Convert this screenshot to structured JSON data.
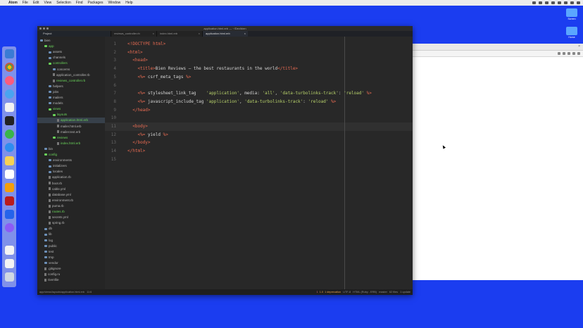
{
  "menubar": {
    "items": [
      "Atom",
      "File",
      "Edit",
      "View",
      "Selection",
      "Find",
      "Packages",
      "Window",
      "Help"
    ]
  },
  "desktop": {
    "icons": [
      "Screen",
      "Home"
    ]
  },
  "window": {
    "title": "application.html.erb — ~/Dev/bien",
    "project_tab": "Project",
    "tabs": [
      {
        "label": "reviews_controller.rb",
        "active": false
      },
      {
        "label": "index.html.erb",
        "active": false
      },
      {
        "label": "application.html.erb",
        "active": true
      }
    ],
    "close_glyph": "×"
  },
  "tree": [
    {
      "label": "bien",
      "depth": 0,
      "kind": "folder",
      "green": false
    },
    {
      "label": "app",
      "depth": 1,
      "kind": "folder",
      "green": true
    },
    {
      "label": "assets",
      "depth": 2,
      "kind": "folder",
      "green": false
    },
    {
      "label": "channels",
      "depth": 2,
      "kind": "folder",
      "green": false
    },
    {
      "label": "controllers",
      "depth": 2,
      "kind": "folder",
      "green": true
    },
    {
      "label": "concerns",
      "depth": 3,
      "kind": "folder",
      "green": false
    },
    {
      "label": "application_controller.rb",
      "depth": 3,
      "kind": "file",
      "green": false
    },
    {
      "label": "reviews_controller.rb",
      "depth": 3,
      "kind": "file",
      "green": true
    },
    {
      "label": "helpers",
      "depth": 2,
      "kind": "folder",
      "green": false
    },
    {
      "label": "jobs",
      "depth": 2,
      "kind": "folder",
      "green": false
    },
    {
      "label": "mailers",
      "depth": 2,
      "kind": "folder",
      "green": false
    },
    {
      "label": "models",
      "depth": 2,
      "kind": "folder",
      "green": false
    },
    {
      "label": "views",
      "depth": 2,
      "kind": "folder",
      "green": true
    },
    {
      "label": "layouts",
      "depth": 3,
      "kind": "folder",
      "green": true
    },
    {
      "label": "application.html.erb",
      "depth": 4,
      "kind": "file",
      "green": true,
      "selected": true
    },
    {
      "label": "mailer.html.erb",
      "depth": 4,
      "kind": "file",
      "green": false
    },
    {
      "label": "mailer.text.erb",
      "depth": 4,
      "kind": "file",
      "green": false
    },
    {
      "label": "reviews",
      "depth": 3,
      "kind": "folder",
      "green": true
    },
    {
      "label": "index.html.erb",
      "depth": 4,
      "kind": "file",
      "green": true
    },
    {
      "label": "bin",
      "depth": 1,
      "kind": "folder",
      "green": false
    },
    {
      "label": "config",
      "depth": 1,
      "kind": "folder",
      "green": true
    },
    {
      "label": "environments",
      "depth": 2,
      "kind": "folder",
      "green": false
    },
    {
      "label": "initializers",
      "depth": 2,
      "kind": "folder",
      "green": false
    },
    {
      "label": "locales",
      "depth": 2,
      "kind": "folder",
      "green": false
    },
    {
      "label": "application.rb",
      "depth": 2,
      "kind": "file",
      "green": false
    },
    {
      "label": "boot.rb",
      "depth": 2,
      "kind": "file",
      "green": false
    },
    {
      "label": "cable.yml",
      "depth": 2,
      "kind": "file",
      "green": false
    },
    {
      "label": "database.yml",
      "depth": 2,
      "kind": "file",
      "green": false
    },
    {
      "label": "environment.rb",
      "depth": 2,
      "kind": "file",
      "green": false
    },
    {
      "label": "puma.rb",
      "depth": 2,
      "kind": "file",
      "green": false
    },
    {
      "label": "routes.rb",
      "depth": 2,
      "kind": "file",
      "green": true
    },
    {
      "label": "secrets.yml",
      "depth": 2,
      "kind": "file",
      "green": false
    },
    {
      "label": "spring.rb",
      "depth": 2,
      "kind": "file",
      "green": false
    },
    {
      "label": "db",
      "depth": 1,
      "kind": "folder",
      "green": false
    },
    {
      "label": "lib",
      "depth": 1,
      "kind": "folder",
      "green": false
    },
    {
      "label": "log",
      "depth": 1,
      "kind": "folder",
      "green": false
    },
    {
      "label": "public",
      "depth": 1,
      "kind": "folder",
      "green": false
    },
    {
      "label": "test",
      "depth": 1,
      "kind": "folder",
      "green": false
    },
    {
      "label": "tmp",
      "depth": 1,
      "kind": "folder",
      "green": false
    },
    {
      "label": "vendor",
      "depth": 1,
      "kind": "folder",
      "green": false
    },
    {
      "label": ".gitignore",
      "depth": 1,
      "kind": "file",
      "green": false
    },
    {
      "label": "config.ru",
      "depth": 1,
      "kind": "file",
      "green": false
    },
    {
      "label": "Gemfile",
      "depth": 1,
      "kind": "file",
      "green": false
    }
  ],
  "editor": {
    "cursor_line": 11,
    "lines": [
      [
        [
          "<!DOCTYPE html>",
          "t"
        ]
      ],
      [
        [
          "<html>",
          "t"
        ]
      ],
      [
        [
          "  ",
          "w"
        ],
        [
          "<head>",
          "t"
        ]
      ],
      [
        [
          "    ",
          "w"
        ],
        [
          "<title>",
          "t"
        ],
        [
          "Bien Reviews — the best restaurants in the world",
          "w"
        ],
        [
          "</title>",
          "t"
        ]
      ],
      [
        [
          "    ",
          "w"
        ],
        [
          "<%=",
          "e"
        ],
        [
          " csrf_meta_tags ",
          "w"
        ],
        [
          "%>",
          "e"
        ]
      ],
      [
        [
          "",
          "w"
        ]
      ],
      [
        [
          "    ",
          "w"
        ],
        [
          "<%=",
          "e"
        ],
        [
          " stylesheet_link_tag    ",
          "w"
        ],
        [
          "'application'",
          "s"
        ],
        [
          ", media: ",
          "w"
        ],
        [
          "'all'",
          "s"
        ],
        [
          ", ",
          "w"
        ],
        [
          "'data-turbolinks-track'",
          "s"
        ],
        [
          ": ",
          "w"
        ],
        [
          "'reload'",
          "s"
        ],
        [
          " ",
          "w"
        ],
        [
          "%>",
          "e"
        ]
      ],
      [
        [
          "    ",
          "w"
        ],
        [
          "<%=",
          "e"
        ],
        [
          " javascript_include_tag ",
          "w"
        ],
        [
          "'application'",
          "s"
        ],
        [
          ", ",
          "w"
        ],
        [
          "'data-turbolinks-track'",
          "s"
        ],
        [
          ": ",
          "w"
        ],
        [
          "'reload'",
          "s"
        ],
        [
          " ",
          "w"
        ],
        [
          "%>",
          "e"
        ]
      ],
      [
        [
          "  ",
          "w"
        ],
        [
          "</head>",
          "t"
        ]
      ],
      [
        [
          "",
          "w"
        ]
      ],
      [
        [
          "  ",
          "w"
        ],
        [
          "<body>",
          "t"
        ]
      ],
      [
        [
          "    ",
          "w"
        ],
        [
          "<%=",
          "e"
        ],
        [
          " yield ",
          "w"
        ],
        [
          "%>",
          "e"
        ]
      ],
      [
        [
          "  ",
          "w"
        ],
        [
          "</body>",
          "t"
        ]
      ],
      [
        [
          "</html>",
          "t"
        ]
      ],
      [
        [
          "",
          "w"
        ]
      ]
    ]
  },
  "status": {
    "left": "app/views/layouts/application.html.erb",
    "position": "11:6",
    "errors": "1",
    "warnings": "1.0",
    "deprecation": "1 deprecation",
    "encoding": "UTF-8",
    "grammar": "HTML (Ruby - ERB)",
    "branch": "master",
    "files": "62 files",
    "updates": "1 update"
  }
}
